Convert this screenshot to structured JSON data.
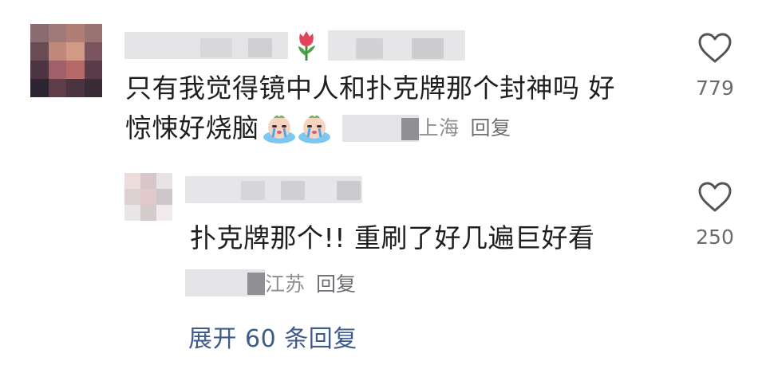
{
  "main_comment": {
    "text_line1": "只有我觉得镜中人和扑克牌那个封神吗 好",
    "text_line2": "惊悚好烧脑",
    "location": "上海",
    "reply_label": "回复",
    "like_count": "779",
    "username_emoji": "🌷"
  },
  "reply_comment": {
    "text": "扑克牌那个!!  重刷了好几遍巨好看",
    "location": "江苏",
    "reply_label": "回复",
    "like_count": "250"
  },
  "expand_replies": {
    "label": "展开 60 条回复"
  },
  "icons": {
    "heart": "heart-outline-icon",
    "emoji": "crying-face-emoji-icon",
    "tulip": "tulip-emoji-icon"
  },
  "colors": {
    "text": "#1f1f1f",
    "meta": "#8e8e93",
    "link": "#3f5b8a",
    "heart_stroke": "#555555"
  }
}
